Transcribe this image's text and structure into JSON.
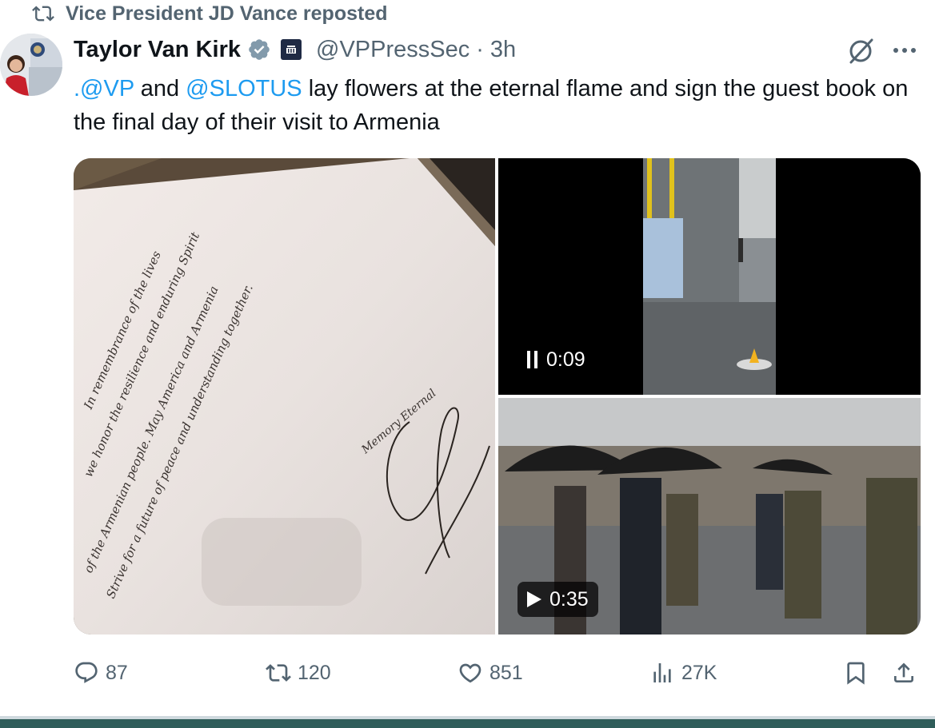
{
  "repost": {
    "label": "Vice President JD Vance reposted",
    "icon": "repost-icon"
  },
  "author": {
    "name": "Taylor Van Kirk",
    "handle": "@VPPressSec",
    "separator": "·",
    "time": "3h",
    "verified_color": "#829aab"
  },
  "text": {
    "m1": ".@VP",
    "t1": " and ",
    "m2": "@SLOTUS",
    "t2": " lay flowers at the eternal flame and sign the guest book on the final day of their visit to Armenia"
  },
  "handwriting": {
    "line1": "In remembrance of the lives",
    "line2": "we honor the resilience and enduring Spirit",
    "line3": "of the Armenian people. May America and Armenia",
    "line4": "Strive for a future of peace and understanding together.",
    "note": "Memory Eternal"
  },
  "videos": [
    {
      "state_icon": "pause-icon",
      "duration": "0:09"
    },
    {
      "state_icon": "play-icon",
      "duration": "0:35"
    }
  ],
  "actions": {
    "replies": "87",
    "reposts": "120",
    "likes": "851",
    "views": "27K"
  },
  "colors": {
    "mention": "#1d9bf0",
    "secondary_text": "#536471",
    "primary_text": "#0f1419"
  }
}
